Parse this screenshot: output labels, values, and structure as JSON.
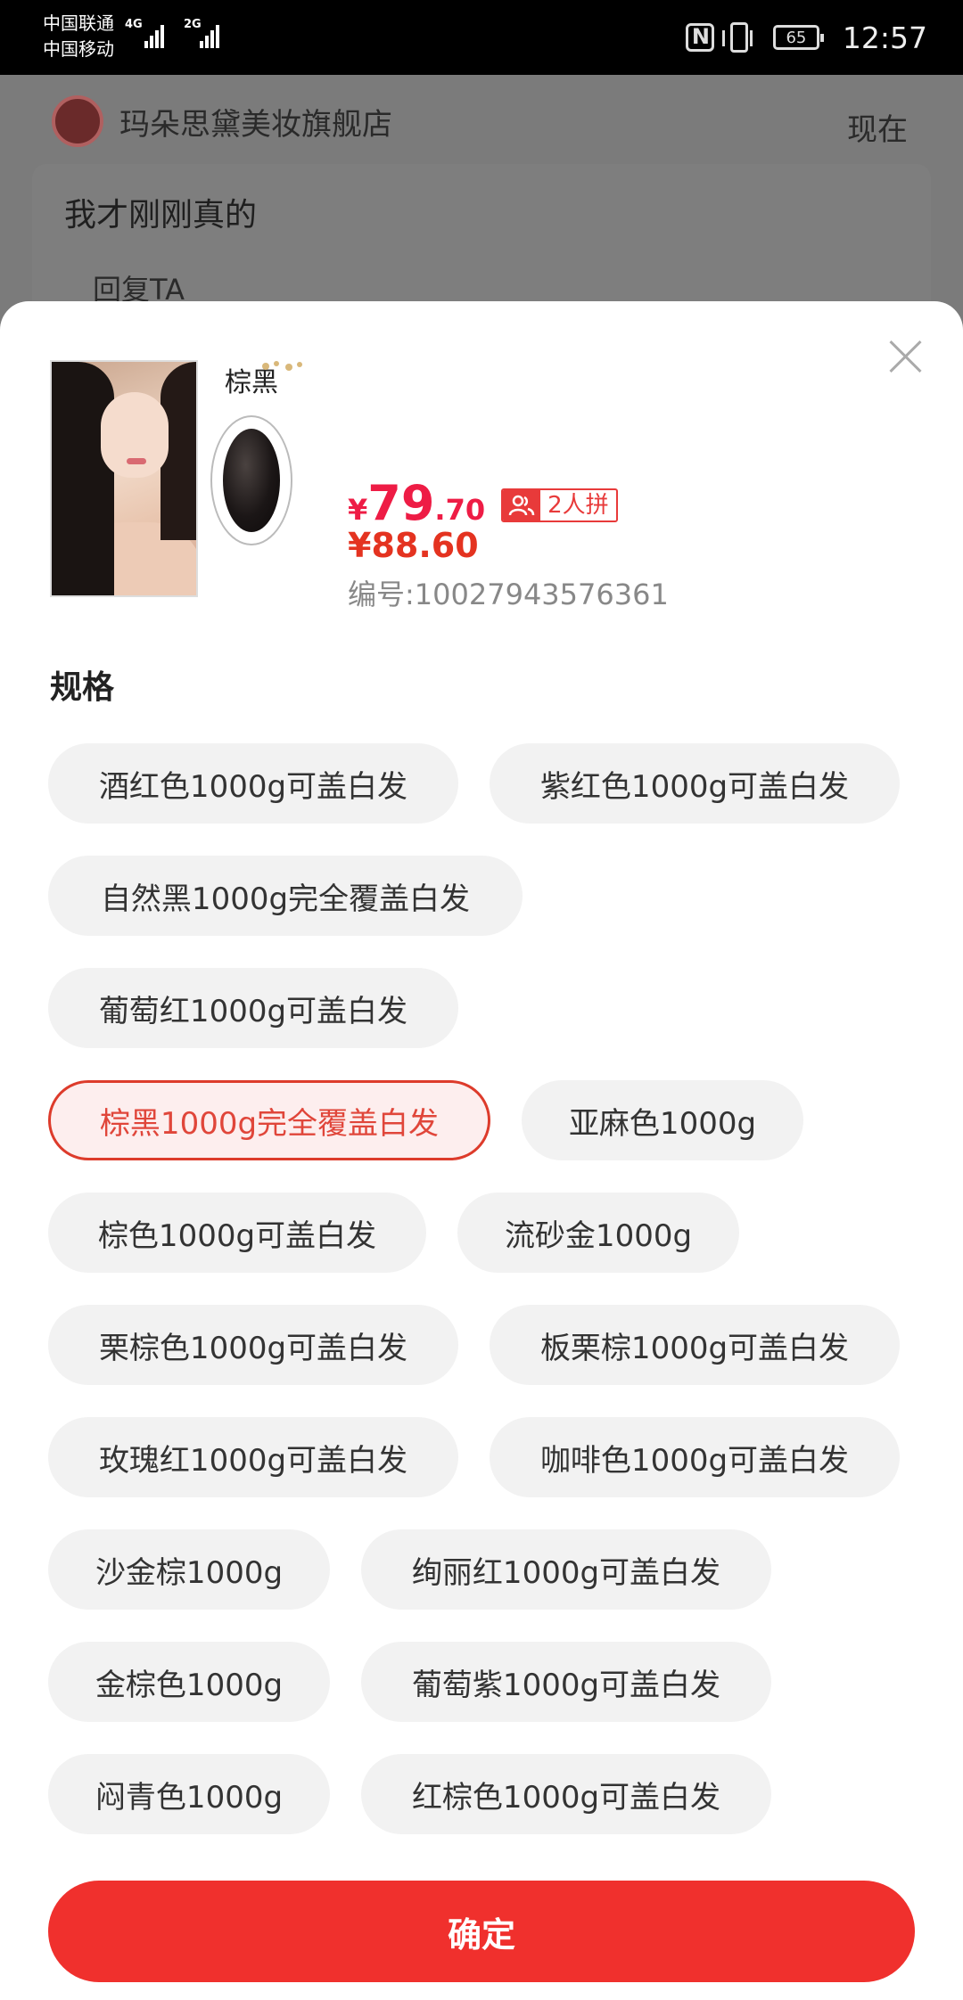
{
  "status_bar": {
    "carrier1": "中国联通",
    "carrier2": "中国移动",
    "net1": "4G",
    "net2": "2G",
    "battery": "65",
    "time": "12:57"
  },
  "background": {
    "shop_name": "玛朵思黛美妆旗舰店",
    "time": "现在",
    "message": "我才刚刚真的",
    "reply": "回复TA"
  },
  "product": {
    "swatch_name": "棕黑",
    "price_currency": "¥",
    "price_integer": "79",
    "price_decimal": ".70",
    "group_badge": "2人拼",
    "original_price": "¥88.60",
    "sku_number": "编号:10027943576361"
  },
  "spec": {
    "title": "规格",
    "options": [
      {
        "label": "酒红色1000g可盖白发",
        "selected": false
      },
      {
        "label": "紫红色1000g可盖白发",
        "selected": false
      },
      {
        "label": "自然黑1000g完全覆盖白发",
        "selected": false
      },
      {
        "label": "葡萄红1000g可盖白发",
        "selected": false
      },
      {
        "label": "棕黑1000g完全覆盖白发",
        "selected": true
      },
      {
        "label": "亚麻色1000g",
        "selected": false
      },
      {
        "label": "棕色1000g可盖白发",
        "selected": false
      },
      {
        "label": "流砂金1000g",
        "selected": false
      },
      {
        "label": "栗棕色1000g可盖白发",
        "selected": false
      },
      {
        "label": "板栗棕1000g可盖白发",
        "selected": false
      },
      {
        "label": "玫瑰红1000g可盖白发",
        "selected": false
      },
      {
        "label": "咖啡色1000g可盖白发",
        "selected": false
      },
      {
        "label": "沙金棕1000g",
        "selected": false
      },
      {
        "label": "绚丽红1000g可盖白发",
        "selected": false
      },
      {
        "label": "金棕色1000g",
        "selected": false
      },
      {
        "label": "葡萄紫1000g可盖白发",
        "selected": false
      },
      {
        "label": "闷青色1000g",
        "selected": false
      },
      {
        "label": "红棕色1000g可盖白发",
        "selected": false
      }
    ]
  },
  "confirm_label": "确定",
  "colors": {
    "accent_red": "#f0302d",
    "price_red": "#ee1c45",
    "selected_border": "#dd3b2b"
  }
}
